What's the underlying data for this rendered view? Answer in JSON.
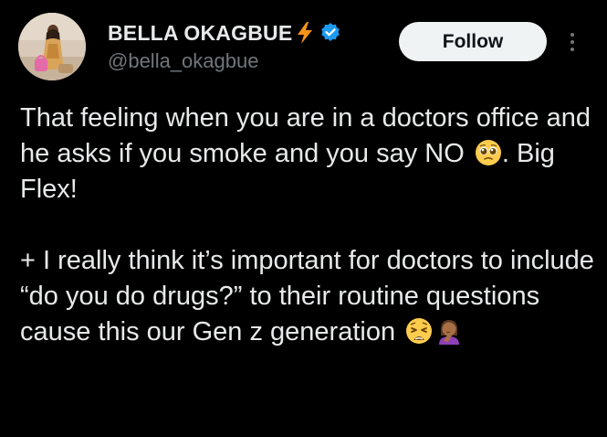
{
  "author": {
    "display_name": "BELLA OKAGBUE",
    "handle": "@bella_okagbue",
    "avatar_icon": "profile-photo",
    "name_emoji_icon": "high-voltage-emoji",
    "verified_icon": "verified-badge-icon"
  },
  "actions": {
    "follow_label": "Follow",
    "more_icon": "more-options-icon"
  },
  "tweet": {
    "p1_text": "That feeling when you are in a doctors office and he asks if you smoke and you say NO",
    "p1_emoji": "pleading-face-emoji",
    "p1_tail": ". Big Flex!",
    "p2_text": "+ I really think it’s important for doctors to include “do you do drugs?” to their routine questions cause this our Gen z generation",
    "p2_emoji_1": "weary-face-emoji",
    "p2_emoji_2": "woman-facepalming-emoji"
  },
  "colors": {
    "background": "#000000",
    "text_primary": "#e7e9ea",
    "text_secondary": "#71767b",
    "verified_blue": "#1d9bf0",
    "bolt_orange": "#f7931a",
    "follow_bg": "#eff3f4"
  }
}
